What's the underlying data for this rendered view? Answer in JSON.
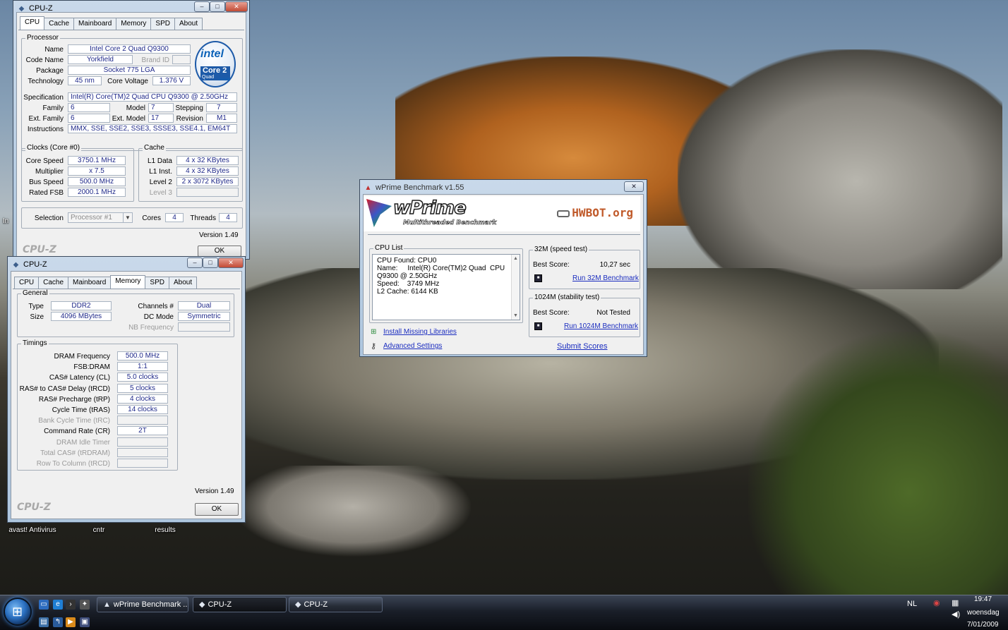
{
  "desktop": {
    "icons": [
      "avast! Antivirus",
      "cntr",
      "results"
    ],
    "partial_icon": "In"
  },
  "cpuz1": {
    "title": "CPU-Z",
    "tabs": [
      "CPU",
      "Cache",
      "Mainboard",
      "Memory",
      "SPD",
      "About"
    ],
    "processor": {
      "group": "Processor",
      "name_label": "Name",
      "name": "Intel Core 2 Quad Q9300",
      "codename_label": "Code Name",
      "codename": "Yorkfield",
      "brandid_label": "Brand ID",
      "package_label": "Package",
      "package": "Socket 775 LGA",
      "technology_label": "Technology",
      "technology": "45 nm",
      "voltage_label": "Core Voltage",
      "voltage": "1.376 V",
      "spec_label": "Specification",
      "spec": "Intel(R) Core(TM)2 Quad  CPU   Q9300  @ 2.50GHz",
      "family_label": "Family",
      "family": "6",
      "model_label": "Model",
      "model": "7",
      "stepping_label": "Stepping",
      "stepping": "7",
      "extfamily_label": "Ext. Family",
      "extfamily": "6",
      "extmodel_label": "Ext. Model",
      "extmodel": "17",
      "revision_label": "Revision",
      "revision": "M1",
      "instr_label": "Instructions",
      "instr": "MMX, SSE, SSE2, SSE3, SSSE3, SSE4.1, EM64T"
    },
    "intel_logo": {
      "brand": "intel",
      "line": "Core 2",
      "sub": "Quad",
      "inside": "inside"
    },
    "clocks": {
      "group": "Clocks (Core #0)",
      "speed_label": "Core Speed",
      "speed": "3750.1 MHz",
      "mult_label": "Multiplier",
      "mult": "x 7.5",
      "bus_label": "Bus Speed",
      "bus": "500.0 MHz",
      "fsb_label": "Rated FSB",
      "fsb": "2000.1 MHz"
    },
    "cache": {
      "group": "Cache",
      "l1d_label": "L1 Data",
      "l1d": "4 x 32 KBytes",
      "l1i_label": "L1 Inst.",
      "l1i": "4 x 32 KBytes",
      "l2_label": "Level 2",
      "l2": "2 x 3072 KBytes",
      "l3_label": "Level 3"
    },
    "selection_label": "Selection",
    "selection": "Processor #1",
    "cores_label": "Cores",
    "cores": "4",
    "threads_label": "Threads",
    "threads": "4",
    "version": "Version 1.49",
    "logo": "CPU-Z",
    "ok": "OK"
  },
  "cpuz2": {
    "title": "CPU-Z",
    "tabs": [
      "CPU",
      "Cache",
      "Mainboard",
      "Memory",
      "SPD",
      "About"
    ],
    "general": {
      "group": "General",
      "type_label": "Type",
      "type": "DDR2",
      "size_label": "Size",
      "size": "4096 MBytes",
      "channels_label": "Channels #",
      "channels": "Dual",
      "dcmode_label": "DC Mode",
      "dcmode": "Symmetric",
      "nbfreq_label": "NB Frequency"
    },
    "timings": {
      "group": "Timings",
      "rows": [
        {
          "label": "DRAM Frequency",
          "value": "500.0 MHz",
          "enabled": true
        },
        {
          "label": "FSB:DRAM",
          "value": "1:1",
          "enabled": true
        },
        {
          "label": "CAS# Latency (CL)",
          "value": "5.0 clocks",
          "enabled": true
        },
        {
          "label": "RAS# to CAS# Delay (tRCD)",
          "value": "5 clocks",
          "enabled": true
        },
        {
          "label": "RAS# Precharge (tRP)",
          "value": "4 clocks",
          "enabled": true
        },
        {
          "label": "Cycle Time (tRAS)",
          "value": "14 clocks",
          "enabled": true
        },
        {
          "label": "Bank Cycle Time (tRC)",
          "value": "",
          "enabled": false
        },
        {
          "label": "Command Rate (CR)",
          "value": "2T",
          "enabled": true
        },
        {
          "label": "DRAM Idle Timer",
          "value": "",
          "enabled": false
        },
        {
          "label": "Total CAS# (tRDRAM)",
          "value": "",
          "enabled": false
        },
        {
          "label": "Row To Column (tRCD)",
          "value": "",
          "enabled": false
        }
      ]
    },
    "version": "Version 1.49",
    "logo": "CPU-Z",
    "ok": "OK"
  },
  "wprime": {
    "title": "wPrime Benchmark v1.55",
    "logo_name": "wPrime",
    "logo_sub": "Multithreaded Benchmark",
    "hwbot": "HWBOT.org",
    "cpulist": {
      "group": "CPU List",
      "lines": [
        "CPU Found: CPU0",
        "Name:     Intel(R) Core(TM)2 Quad  CPU",
        "Q9300  @ 2.50GHz",
        "Speed:    3749 MHz",
        "L2 Cache: 6144 KB"
      ]
    },
    "speed": {
      "group": "32M (speed test)",
      "best_label": "Best Score:",
      "best": "10,27 sec",
      "run": "Run 32M Benchmark"
    },
    "stability": {
      "group": "1024M (stability test)",
      "best_label": "Best Score:",
      "best": "Not Tested",
      "run": "Run 1024M Benchmark"
    },
    "install": "Install Missing Libraries",
    "advanced": "Advanced Settings",
    "submit": "Submit Scores"
  },
  "taskbar": {
    "buttons": [
      "wPrime Benchmark ...",
      "CPU-Z",
      "CPU-Z"
    ],
    "lang": "NL",
    "time": "19:47",
    "day": "woensdag",
    "date": "7/01/2009"
  },
  "colors": {
    "value_text": "#202a8a",
    "link": "#1a2cbf",
    "taskbar": "#1a1f29"
  }
}
